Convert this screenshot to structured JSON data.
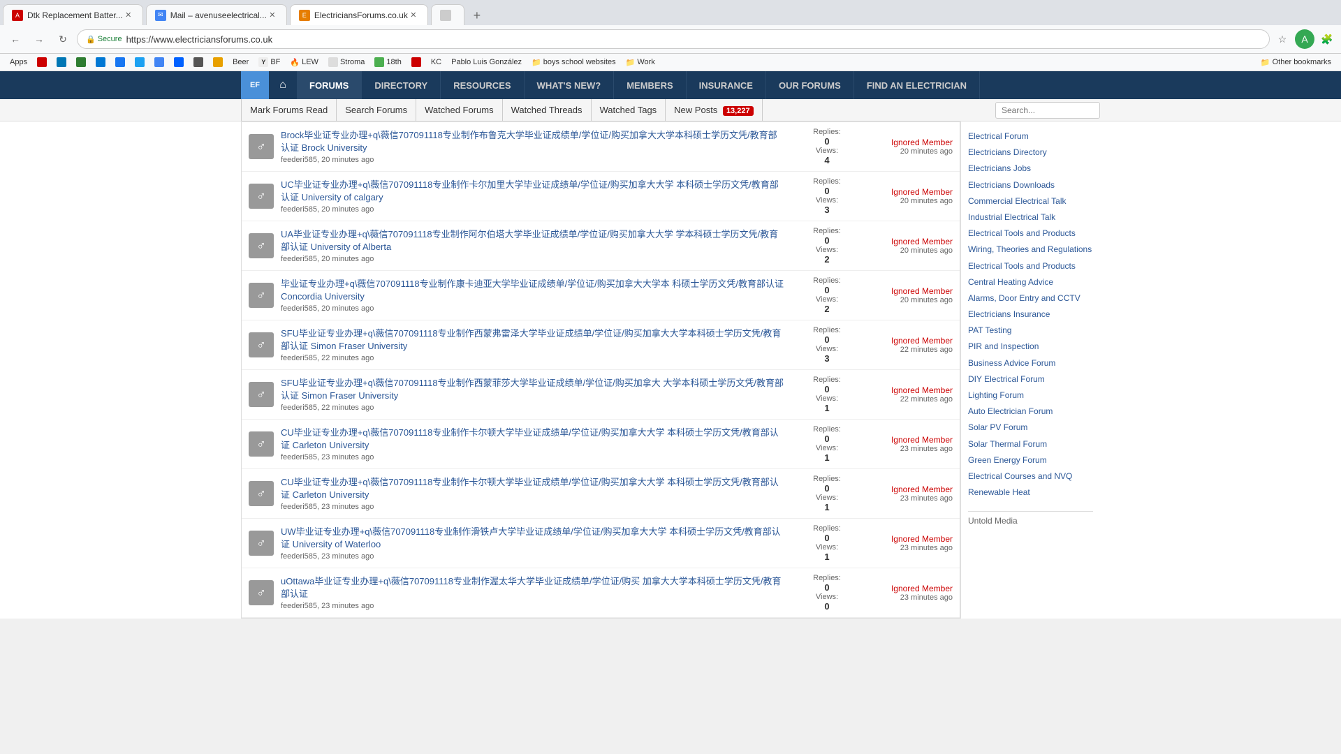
{
  "browser": {
    "tabs": [
      {
        "id": 1,
        "title": "Dtk Replacement Batter...",
        "favicon_letter": "A",
        "favicon_bg": "#cc0000",
        "active": false
      },
      {
        "id": 2,
        "title": "Mail – avenuseelectrical...",
        "favicon_letter": "M",
        "favicon_bg": "#4285f4",
        "active": false
      },
      {
        "id": 3,
        "title": "ElectriciansForums.co.uk",
        "favicon_letter": "E",
        "favicon_bg": "#e67e00",
        "active": true
      },
      {
        "id": 4,
        "title": "",
        "favicon_letter": "",
        "favicon_bg": "#ccc",
        "active": false
      }
    ],
    "address": "https://www.electriciansforums.co.uk",
    "secure_label": "Secure",
    "user_avatar": "Andy"
  },
  "bookmarks": [
    {
      "label": "Apps",
      "type": "folder"
    },
    {
      "label": "",
      "favicon_bg": "#cc0000",
      "type": "favicon"
    },
    {
      "label": "",
      "favicon_bg": "#0077b5",
      "type": "favicon"
    },
    {
      "label": "",
      "favicon_bg": "#2e7d32",
      "type": "favicon"
    },
    {
      "label": "",
      "favicon_bg": "#0078d4",
      "type": "favicon"
    },
    {
      "label": "",
      "favicon_bg": "#1877f2",
      "type": "favicon"
    },
    {
      "label": "",
      "favicon_bg": "#1da1f2",
      "type": "favicon"
    },
    {
      "label": "",
      "favicon_bg": "#4285f4",
      "type": "favicon"
    },
    {
      "label": "",
      "favicon_bg": "#34a853",
      "type": "favicon"
    },
    {
      "label": "",
      "favicon_bg": "#555",
      "type": "favicon"
    },
    {
      "label": "",
      "favicon_bg": "#e8a000",
      "type": "favicon"
    },
    {
      "label": "Beer",
      "type": "text"
    },
    {
      "label": "BF",
      "type": "text"
    },
    {
      "label": "LEW",
      "type": "text"
    },
    {
      "label": "Stroma",
      "type": "text"
    },
    {
      "label": "",
      "favicon_bg": "#4caf50",
      "type": "favicon"
    },
    {
      "label": "18th",
      "type": "text"
    },
    {
      "label": "",
      "favicon_bg": "#cc0000",
      "type": "favicon"
    },
    {
      "label": "KC",
      "type": "text"
    },
    {
      "label": "Pablo Luis González",
      "type": "text"
    },
    {
      "label": "boys school websites",
      "type": "folder"
    },
    {
      "label": "Work",
      "type": "folder"
    },
    {
      "label": "Other bookmarks",
      "type": "other"
    }
  ],
  "nav": {
    "items": [
      "FORUMS",
      "DIRECTORY",
      "RESOURCES",
      "WHAT'S NEW?",
      "MEMBERS",
      "INSURANCE",
      "OUR FORUMS",
      "FIND AN ELECTRICIAN"
    ]
  },
  "subnav": {
    "items": [
      "Mark Forums Read",
      "Search Forums",
      "Watched Forums",
      "Watched Threads",
      "Watched Tags",
      "New Posts"
    ],
    "new_posts_count": "13,227",
    "search_placeholder": "Search..."
  },
  "sidebar": {
    "links": [
      "Electrical Forum",
      "Electricians Directory",
      "Electricians Jobs",
      "Electricians Downloads",
      "Commercial Electrical Talk",
      "Industrial Electrical Talk",
      "Electrical Tools and Products",
      "Wiring, Theories and Regulations",
      "Electrical Tools and Products",
      "Central Heating Advice",
      "Alarms, Door Entry and CCTV",
      "Electricians Insurance",
      "PAT Testing",
      "PIR and Inspection",
      "Business Advice Forum",
      "DIY Electrical Forum",
      "Lighting Forum",
      "Auto Electrician Forum",
      "Solar PV Forum",
      "Solar Thermal Forum",
      "Green Energy Forum",
      "Electrical Courses and NVQ",
      "Renewable Heat"
    ],
    "special": "Untold Media"
  },
  "threads": [
    {
      "title": "Brock毕业证专业办理+q\\薇信707091118专业制作布鲁克大学毕业证成绩单/学位证/购买加拿大大学本科硕士学历文凭/教育部认证 Brock University",
      "author": "feederi585",
      "time": "20 minutes ago",
      "replies": 0,
      "views": 4,
      "last_user": "Ignored Member",
      "last_time": "20 minutes ago"
    },
    {
      "title": "UC毕业证专业办理+q\\薇信707091118专业制作卡尔加里大学毕业证成绩单/学位证/购买加拿大大学 本科硕士学历文凭/教育部认证 University of calgary",
      "author": "feederi585",
      "time": "20 minutes ago",
      "replies": 0,
      "views": 3,
      "last_user": "Ignored Member",
      "last_time": "20 minutes ago"
    },
    {
      "title": "UA毕业证专业办理+q\\薇信707091118专业制作阿尔伯塔大学毕业证成绩单/学位证/购买加拿大大学 学本科硕士学历文凭/教育部认证 University of Alberta",
      "author": "feederi585",
      "time": "20 minutes ago",
      "replies": 0,
      "views": 2,
      "last_user": "Ignored Member",
      "last_time": "20 minutes ago"
    },
    {
      "title": "毕业证专业办理+q\\薇信707091118专业制作康卡迪亚大学毕业证成绩单/学位证/购买加拿大大学本 科硕士学历文凭/教育部认证 Concordia University",
      "author": "feederi585",
      "time": "20 minutes ago",
      "replies": 0,
      "views": 2,
      "last_user": "Ignored Member",
      "last_time": "20 minutes ago"
    },
    {
      "title": "SFU毕业证专业办理+q\\薇信707091118专业制作西蒙弗雷泽大学毕业证成绩单/学位证/购买加拿大大学本科硕士学历文凭/教育部认证 Simon Fraser University",
      "author": "feederi585",
      "time": "22 minutes ago",
      "replies": 0,
      "views": 3,
      "last_user": "Ignored Member",
      "last_time": "22 minutes ago"
    },
    {
      "title": "SFU毕业证专业办理+q\\薇信707091118专业制作西蒙菲莎大学毕业证成绩单/学位证/购买加拿大 大学本科硕士学历文凭/教育部认证 Simon Fraser University",
      "author": "feederi585",
      "time": "22 minutes ago",
      "replies": 0,
      "views": 1,
      "last_user": "Ignored Member",
      "last_time": "22 minutes ago"
    },
    {
      "title": "CU毕业证专业办理+q\\薇信707091118专业制作卡尔顿大学毕业证成绩单/学位证/购买加拿大大学 本科硕士学历文凭/教育部认证 Carleton University",
      "author": "feederi585",
      "time": "23 minutes ago",
      "replies": 0,
      "views": 1,
      "last_user": "Ignored Member",
      "last_time": "23 minutes ago"
    },
    {
      "title": "CU毕业证专业办理+q\\薇信707091118专业制作卡尔顿大学毕业证成绩单/学位证/购买加拿大大学 本科硕士学历文凭/教育部认证 Carleton University",
      "author": "feederi585",
      "time": "23 minutes ago",
      "replies": 0,
      "views": 1,
      "last_user": "Ignored Member",
      "last_time": "23 minutes ago"
    },
    {
      "title": "UW毕业证专业办理+q\\薇信707091118专业制作滑铁卢大学毕业证成绩单/学位证/购买加拿大大学 本科硕士学历文凭/教育部认证 University of Waterloo",
      "author": "feederi585",
      "time": "23 minutes ago",
      "replies": 0,
      "views": 1,
      "last_user": "Ignored Member",
      "last_time": "23 minutes ago"
    },
    {
      "title": "uOttawa毕业证专业办理+q\\薇信707091118专业制作渥太华大学毕业证成绩单/学位证/购买 加拿大大学本科硕士学历文凭/教育部认证",
      "author": "feederi585",
      "time": "23 minutes ago",
      "replies": 0,
      "views": 0,
      "last_user": "Ignored Member",
      "last_time": "23 minutes ago"
    }
  ],
  "labels": {
    "replies": "Replies:",
    "views": "Views:"
  }
}
